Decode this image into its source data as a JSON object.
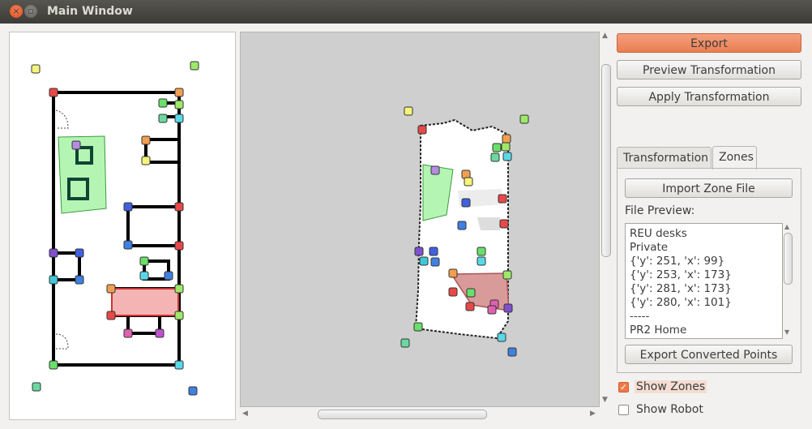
{
  "window": {
    "title": "Main Window",
    "close_glyph": "×",
    "max_glyph": "▫"
  },
  "buttons": {
    "export": "Export",
    "preview_transformation": "Preview Transformation",
    "apply_transformation": "Apply Transformation",
    "import_zone_file": "Import Zone File",
    "export_converted_points": "Export Converted Points"
  },
  "tabs": [
    {
      "label": "Transformation"
    },
    {
      "label": "Zones"
    }
  ],
  "zones_tab": {
    "file_preview_label": "File Preview:",
    "file_preview_lines": [
      "REU desks",
      "Private",
      "{'y': 251, 'x': 99}",
      "{'y': 253, 'x': 173}",
      "{'y': 281, 'x': 173}",
      "{'y': 280, 'x': 101}",
      "-----",
      "PR2 Home"
    ]
  },
  "checkboxes": {
    "show_zones": {
      "label": "Show Zones",
      "checked": true
    },
    "show_robot": {
      "label": "Show Robot",
      "checked": false
    }
  },
  "colors": {
    "accent": "#eb7e51",
    "zone_green": "#b4f5b4",
    "zone_red": "#f5b4b4"
  },
  "icons": [
    "close-icon",
    "maximize-icon",
    "scroll-up-icon",
    "scroll-down-icon",
    "scroll-left-icon",
    "scroll-right-icon",
    "checkmark-icon",
    "grip-icon"
  ]
}
